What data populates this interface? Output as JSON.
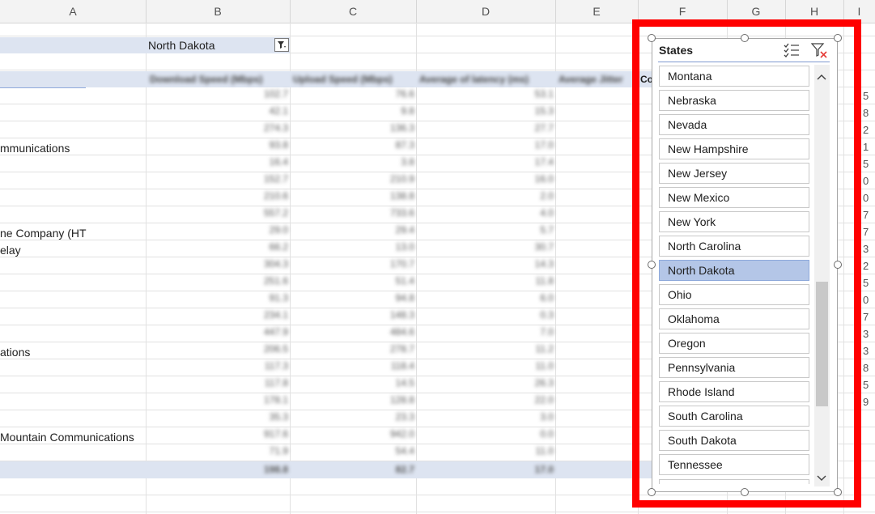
{
  "columns": [
    "A",
    "B",
    "C",
    "D",
    "E",
    "F",
    "G",
    "H",
    "I"
  ],
  "filter_cell": {
    "value": "North Dakota"
  },
  "pivot_headers": [
    "Download Speed (Mbps)",
    "Upload Speed (Mbps)",
    "Average of latency (ms)",
    "Average Jitter",
    "Co"
  ],
  "row_labels": [
    "mmunications",
    "ne Company (HT",
    "elay",
    "ations",
    "Mountain Communications"
  ],
  "blurred_values": {
    "download": [
      "102.7",
      "42.1",
      "274.3",
      "93.8",
      "16.4",
      "152.7",
      "210.6",
      "557.2",
      "29.0",
      "66.2",
      "304.3",
      "251.6",
      "91.3",
      "234.1",
      "447.9",
      "206.5",
      "117.3",
      "117.8",
      "178.1",
      "35.3",
      "917.6",
      "71.9",
      "198.8"
    ],
    "upload": [
      "76.6",
      "9.8",
      "136.3",
      "87.3",
      "3.8",
      "210.9",
      "138.8",
      "733.6",
      "29.4",
      "13.0",
      "170.7",
      "51.4",
      "94.8",
      "148.3",
      "484.6",
      "278.7",
      "118.4",
      "14.5",
      "128.8",
      "23.3",
      "942.0",
      "54.4",
      "82.7"
    ],
    "latency": [
      "53.1",
      "15.3",
      "27.7",
      "17.0",
      "17.4",
      "16.0",
      "2.0",
      "4.0",
      "5.7",
      "30.7",
      "14.3",
      "11.8",
      "6.0",
      "0.3",
      "7.0",
      "11.2",
      "11.0",
      "26.3",
      "22.0",
      "3.0",
      "0.0",
      "11.0",
      "17.0"
    ]
  },
  "right_edge_digits": [
    "5",
    "8",
    "2",
    "1",
    "5",
    "0",
    "0",
    "7",
    "7",
    "3",
    "2",
    "5",
    "0",
    "7",
    "3",
    "3",
    "8",
    "5",
    "9"
  ],
  "slicer": {
    "title": "States",
    "icons": [
      "multi-select-icon",
      "clear-filter-icon"
    ],
    "items": [
      {
        "label": "Montana",
        "selected": false
      },
      {
        "label": "Nebraska",
        "selected": false
      },
      {
        "label": "Nevada",
        "selected": false
      },
      {
        "label": "New Hampshire",
        "selected": false
      },
      {
        "label": "New Jersey",
        "selected": false
      },
      {
        "label": "New Mexico",
        "selected": false
      },
      {
        "label": "New York",
        "selected": false
      },
      {
        "label": "North Carolina",
        "selected": false
      },
      {
        "label": "North Dakota",
        "selected": true
      },
      {
        "label": "Ohio",
        "selected": false
      },
      {
        "label": "Oklahoma",
        "selected": false
      },
      {
        "label": "Oregon",
        "selected": false
      },
      {
        "label": "Pennsylvania",
        "selected": false
      },
      {
        "label": "Rhode Island",
        "selected": false
      },
      {
        "label": "South Carolina",
        "selected": false
      },
      {
        "label": "South Dakota",
        "selected": false
      },
      {
        "label": "Tennessee",
        "selected": false
      }
    ]
  },
  "colors": {
    "highlight_frame": "#ff0000",
    "selected_item": "#b4c6e7",
    "pivot_band": "#dde4f1"
  }
}
